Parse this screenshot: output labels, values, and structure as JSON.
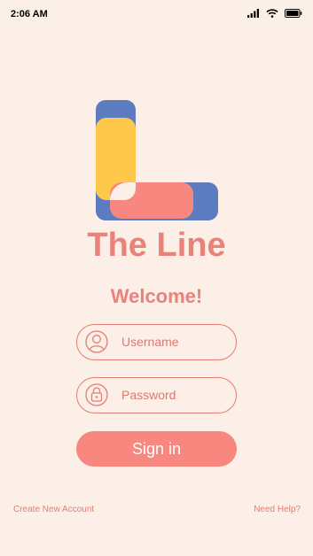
{
  "status_bar": {
    "time": "2:06 AM",
    "icons": [
      "signal-bars-icon",
      "wifi-icon",
      "battery-icon"
    ]
  },
  "logo": {
    "icon": "the-line-logo",
    "colors": {
      "blue": "#5d7bbf",
      "yellow": "#fec94a",
      "salmon": "#f7877f",
      "cream": "#fcefe7"
    }
  },
  "app_title": "The Line",
  "welcome": "Welcome!",
  "username_field": {
    "placeholder": "Username",
    "icon": "user-icon"
  },
  "password_field": {
    "placeholder": "Password",
    "icon": "lock-icon"
  },
  "signin_button": {
    "label": "Sign in"
  },
  "footer": {
    "create_account": "Create New Account",
    "need_help": "Need Help?"
  },
  "colors": {
    "background": "#fcefe7",
    "accent": "#ea827a",
    "button": "#f7877f",
    "outline": "#e37d73"
  }
}
